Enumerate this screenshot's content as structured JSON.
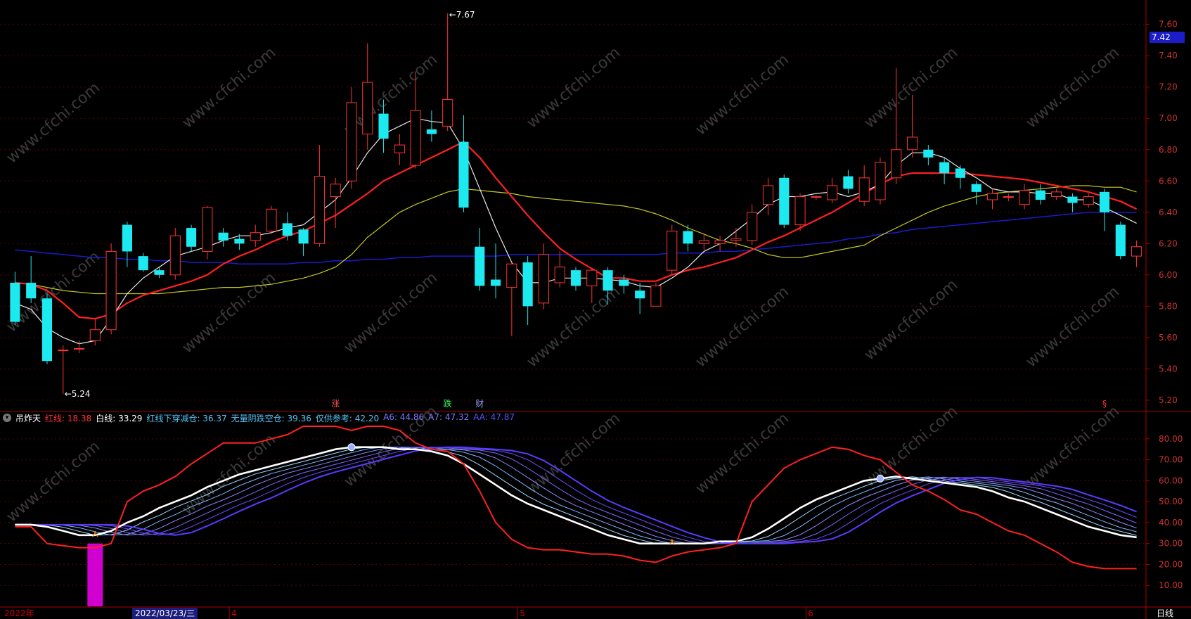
{
  "chart_data": [
    {
      "type": "candlestick",
      "title": "",
      "ylim": [
        5.15,
        7.72
      ],
      "y_ticks": [
        "7.60",
        "7.40",
        "7.20",
        "7.00",
        "6.80",
        "6.60",
        "6.40",
        "6.20",
        "6.00",
        "5.80",
        "5.60",
        "5.40",
        "5.20"
      ],
      "high_label": "7.67",
      "low_label": "5.24",
      "last_price": "7.42",
      "candles": [
        [
          5.95,
          5.7,
          6.02,
          5.68
        ],
        [
          5.95,
          5.85,
          6.12,
          5.82
        ],
        [
          5.85,
          5.45,
          5.88,
          5.43
        ],
        [
          5.52,
          5.52,
          5.55,
          5.24
        ],
        [
          5.53,
          5.53,
          5.58,
          5.5
        ],
        [
          5.58,
          5.65,
          5.72,
          5.55
        ],
        [
          5.65,
          6.15,
          6.2,
          5.62
        ],
        [
          6.32,
          6.15,
          6.34,
          6.05
        ],
        [
          6.12,
          6.03,
          6.14,
          6.02
        ],
        [
          6.03,
          6.0,
          6.05,
          5.98
        ],
        [
          6.0,
          6.25,
          6.3,
          5.97
        ],
        [
          6.3,
          6.18,
          6.32,
          6.15
        ],
        [
          6.15,
          6.43,
          6.44,
          6.1
        ],
        [
          6.27,
          6.22,
          6.3,
          6.18
        ],
        [
          6.23,
          6.2,
          6.26,
          6.16
        ],
        [
          6.22,
          6.27,
          6.32,
          6.18
        ],
        [
          6.28,
          6.42,
          6.44,
          6.26
        ],
        [
          6.33,
          6.25,
          6.4,
          6.22
        ],
        [
          6.29,
          6.2,
          6.3,
          6.12
        ],
        [
          6.2,
          6.63,
          6.83,
          6.18
        ],
        [
          6.5,
          6.58,
          6.62,
          6.3
        ],
        [
          6.6,
          7.1,
          7.2,
          6.55
        ],
        [
          6.9,
          7.23,
          7.48,
          6.8
        ],
        [
          7.03,
          6.87,
          7.12,
          6.78
        ],
        [
          6.78,
          6.83,
          6.9,
          6.7
        ],
        [
          6.7,
          7.05,
          7.3,
          6.68
        ],
        [
          6.93,
          6.9,
          7.05,
          6.85
        ],
        [
          6.95,
          7.12,
          7.67,
          6.92
        ],
        [
          6.85,
          6.43,
          7.02,
          6.4
        ],
        [
          6.18,
          5.93,
          6.3,
          5.9
        ],
        [
          5.97,
          5.93,
          6.2,
          5.85
        ],
        [
          5.92,
          6.07,
          6.08,
          5.61
        ],
        [
          6.08,
          5.8,
          6.12,
          5.68
        ],
        [
          5.82,
          6.13,
          6.2,
          5.78
        ],
        [
          5.95,
          6.05,
          6.15,
          5.92
        ],
        [
          6.03,
          5.93,
          6.05,
          5.9
        ],
        [
          5.93,
          6.03,
          6.04,
          5.82
        ],
        [
          6.03,
          5.9,
          6.05,
          5.81
        ],
        [
          5.97,
          5.93,
          6.0,
          5.88
        ],
        [
          5.9,
          5.85,
          5.95,
          5.75
        ],
        [
          5.8,
          5.93,
          5.95,
          5.8
        ],
        [
          6.03,
          6.28,
          6.32,
          6.0
        ],
        [
          6.28,
          6.2,
          6.32,
          6.15
        ],
        [
          6.2,
          6.22,
          6.26,
          6.16
        ],
        [
          6.2,
          6.22,
          6.25,
          6.15
        ],
        [
          6.22,
          6.23,
          6.3,
          6.18
        ],
        [
          6.22,
          6.4,
          6.45,
          6.19
        ],
        [
          6.45,
          6.57,
          6.62,
          6.38
        ],
        [
          6.62,
          6.32,
          6.64,
          6.3
        ],
        [
          6.32,
          6.5,
          6.52,
          6.28
        ],
        [
          6.5,
          6.5,
          6.51,
          6.48
        ],
        [
          6.48,
          6.57,
          6.62,
          6.46
        ],
        [
          6.63,
          6.55,
          6.67,
          6.52
        ],
        [
          6.47,
          6.62,
          6.7,
          6.44
        ],
        [
          6.48,
          6.72,
          6.75,
          6.45
        ],
        [
          6.62,
          6.8,
          7.32,
          6.58
        ],
        [
          6.8,
          6.88,
          7.15,
          6.75
        ],
        [
          6.8,
          6.75,
          6.83,
          6.7
        ],
        [
          6.72,
          6.65,
          6.75,
          6.58
        ],
        [
          6.68,
          6.62,
          6.7,
          6.55
        ],
        [
          6.58,
          6.53,
          6.6,
          6.45
        ],
        [
          6.48,
          6.52,
          6.55,
          6.42
        ],
        [
          6.5,
          6.5,
          6.52,
          6.47
        ],
        [
          6.45,
          6.54,
          6.58,
          6.42
        ],
        [
          6.54,
          6.48,
          6.58,
          6.45
        ],
        [
          6.5,
          6.53,
          6.55,
          6.48
        ],
        [
          6.5,
          6.46,
          6.52,
          6.4
        ],
        [
          6.45,
          6.5,
          6.52,
          6.43
        ],
        [
          6.53,
          6.4,
          6.55,
          6.28
        ],
        [
          6.32,
          6.12,
          6.34,
          6.1
        ],
        [
          6.12,
          6.18,
          6.22,
          6.05
        ]
      ],
      "ma_white": [
        5.82,
        5.78,
        5.66,
        5.6,
        5.56,
        5.58,
        5.72,
        5.88,
        5.98,
        6.05,
        6.12,
        6.15,
        6.18,
        6.22,
        6.25,
        6.25,
        6.27,
        6.3,
        6.32,
        6.4,
        6.48,
        6.62,
        6.78,
        6.9,
        6.95,
        7.0,
        6.98,
        6.97,
        6.8,
        6.55,
        6.3,
        6.08,
        5.95,
        5.95,
        5.98,
        5.98,
        5.98,
        5.97,
        5.96,
        5.93,
        5.92,
        5.98,
        6.05,
        6.15,
        6.2,
        6.28,
        6.36,
        6.45,
        6.5,
        6.5,
        6.52,
        6.53,
        6.5,
        6.53,
        6.58,
        6.7,
        6.78,
        6.78,
        6.75,
        6.68,
        6.62,
        6.55,
        6.53,
        6.53,
        6.52,
        6.52,
        6.48,
        6.48,
        6.43,
        6.38,
        6.33
      ],
      "ma_red": [
        5.95,
        5.94,
        5.9,
        5.82,
        5.73,
        5.72,
        5.75,
        5.82,
        5.87,
        5.9,
        5.93,
        5.96,
        6.0,
        6.07,
        6.12,
        6.16,
        6.21,
        6.25,
        6.28,
        6.33,
        6.38,
        6.45,
        6.52,
        6.6,
        6.65,
        6.7,
        6.75,
        6.8,
        6.85,
        6.75,
        6.62,
        6.5,
        6.38,
        6.27,
        6.17,
        6.1,
        6.04,
        5.98,
        5.98,
        5.96,
        5.96,
        6.0,
        6.03,
        6.05,
        6.08,
        6.11,
        6.16,
        6.21,
        6.25,
        6.3,
        6.35,
        6.4,
        6.46,
        6.52,
        6.58,
        6.63,
        6.65,
        6.65,
        6.65,
        6.65,
        6.64,
        6.63,
        6.62,
        6.61,
        6.59,
        6.57,
        6.55,
        6.53,
        6.5,
        6.47,
        6.42
      ],
      "ma_yellow": [
        5.95,
        5.94,
        5.92,
        5.9,
        5.89,
        5.88,
        5.88,
        5.88,
        5.88,
        5.88,
        5.89,
        5.9,
        5.91,
        5.92,
        5.92,
        5.93,
        5.94,
        5.96,
        5.98,
        6.01,
        6.05,
        6.13,
        6.24,
        6.32,
        6.4,
        6.45,
        6.49,
        6.53,
        6.55,
        6.54,
        6.53,
        6.52,
        6.5,
        6.49,
        6.48,
        6.47,
        6.46,
        6.45,
        6.44,
        6.42,
        6.39,
        6.35,
        6.3,
        6.26,
        6.22,
        6.2,
        6.17,
        6.13,
        6.11,
        6.11,
        6.13,
        6.15,
        6.17,
        6.19,
        6.25,
        6.3,
        6.35,
        6.4,
        6.44,
        6.47,
        6.5,
        6.52,
        6.53,
        6.54,
        6.55,
        6.56,
        6.57,
        6.57,
        6.56,
        6.56,
        6.53
      ],
      "ma_blue": [
        6.16,
        6.15,
        6.14,
        6.13,
        6.12,
        6.11,
        6.11,
        6.1,
        6.1,
        6.09,
        6.09,
        6.08,
        6.08,
        6.08,
        6.07,
        6.07,
        6.07,
        6.07,
        6.08,
        6.08,
        6.09,
        6.09,
        6.1,
        6.1,
        6.11,
        6.11,
        6.12,
        6.12,
        6.12,
        6.12,
        6.12,
        6.13,
        6.13,
        6.13,
        6.13,
        6.13,
        6.13,
        6.13,
        6.13,
        6.13,
        6.13,
        6.14,
        6.14,
        6.14,
        6.15,
        6.15,
        6.16,
        6.17,
        6.18,
        6.19,
        6.2,
        6.21,
        6.23,
        6.24,
        6.26,
        6.27,
        6.29,
        6.3,
        6.31,
        6.32,
        6.33,
        6.34,
        6.35,
        6.36,
        6.37,
        6.38,
        6.39,
        6.4,
        6.4,
        6.4,
        6.4
      ],
      "markers": [
        {
          "index": 20,
          "text": "涨",
          "color": "#ff5555"
        },
        {
          "index": 27,
          "text": "跌",
          "color": "#33ff66"
        },
        {
          "index": 29,
          "text": "财",
          "color": "#9999ff"
        },
        {
          "index": 68,
          "text": "§",
          "color": "#ff3333"
        }
      ]
    },
    {
      "type": "line",
      "title": "吊炸天",
      "ylim": [
        0,
        88
      ],
      "y_ticks": [
        "80.00",
        "70.00",
        "60.00",
        "50.00",
        "40.00",
        "30.00",
        "20.00",
        "10.00"
      ],
      "legend": [
        {
          "label": "红线:",
          "value": "18.38",
          "color": "#ff3333"
        },
        {
          "label": "白线:",
          "value": "33.29",
          "color": "#ffffff"
        },
        {
          "label": "红线下穿减仓:",
          "value": "36.37",
          "color": "#4fc3f7"
        },
        {
          "label": "无量阴跌空仓:",
          "value": "39.36",
          "color": "#4fc3f7"
        },
        {
          "label": "仅供参考:",
          "value": "42.20",
          "color": "#4fc3f7"
        },
        {
          "label": "A6:",
          "value": "44.86",
          "color": "#7a7aff"
        },
        {
          "label": "A7:",
          "value": "47.32",
          "color": "#7a7aff"
        },
        {
          "label": "AA:",
          "value": "47.87",
          "color": "#5555ff"
        }
      ],
      "red_line": [
        38,
        38,
        30,
        29,
        28,
        28,
        30,
        50,
        55,
        58,
        62,
        68,
        73,
        78,
        78,
        78,
        80,
        82,
        86,
        86,
        86,
        84,
        86,
        86,
        84,
        78,
        75,
        74,
        68,
        55,
        40,
        32,
        28,
        27,
        27,
        26,
        25,
        25,
        24,
        22,
        21,
        24,
        26,
        27,
        28,
        30,
        50,
        58,
        66,
        70,
        73,
        76,
        75,
        72,
        70,
        64,
        58,
        55,
        51,
        46,
        44,
        40,
        36,
        34,
        30,
        26,
        21,
        19,
        18,
        18,
        18
      ],
      "white_line": [
        39,
        39,
        38,
        36,
        34,
        34,
        36,
        40,
        43,
        47,
        50,
        53,
        57,
        60,
        63,
        65,
        67,
        69,
        71,
        73,
        75,
        76,
        76,
        76,
        75,
        75,
        74,
        72,
        68,
        63,
        58,
        53,
        49,
        46,
        43,
        40,
        37,
        34,
        32,
        30,
        30,
        30,
        30,
        30,
        31,
        31,
        33,
        37,
        42,
        47,
        51,
        54,
        57,
        60,
        61,
        62,
        61,
        60,
        59,
        58,
        57,
        55,
        52,
        50,
        47,
        44,
        41,
        38,
        36,
        34,
        33
      ],
      "cross_points": [
        {
          "index": 5,
          "kind": "buy"
        },
        {
          "index": 21,
          "kind": "sell"
        },
        {
          "index": 41,
          "kind": "buy"
        },
        {
          "index": 54,
          "kind": "sell"
        }
      ],
      "bar": {
        "index": 5,
        "value": 30
      }
    }
  ],
  "x_axis": {
    "year_label": "2022年",
    "current_date": "2022/03/23/三",
    "months": [
      {
        "label": "4",
        "index": 14
      },
      {
        "label": "5",
        "index": 32
      },
      {
        "label": "6",
        "index": 50
      }
    ],
    "period": "日线"
  },
  "watermark": "www.cfchi.com"
}
